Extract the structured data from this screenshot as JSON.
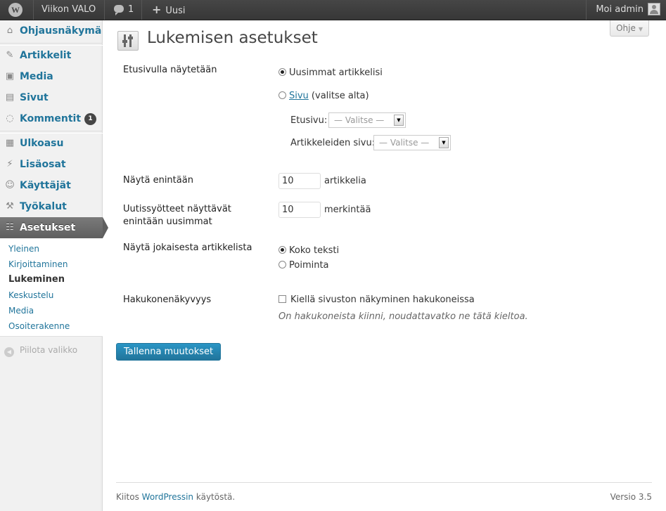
{
  "admin_bar": {
    "site_name": "Viikon VALO",
    "comments_count": "1",
    "new_label": "Uusi",
    "account_label": "Moi admin"
  },
  "sidebar": {
    "items": [
      {
        "label": "Ohjausnäkymä",
        "icon": "dashboard-icon"
      },
      {
        "label": "Artikkelit",
        "icon": "pin-icon"
      },
      {
        "label": "Media",
        "icon": "media-icon"
      },
      {
        "label": "Sivut",
        "icon": "pages-icon"
      },
      {
        "label": "Kommentit",
        "icon": "comments-icon",
        "badge": "1"
      },
      {
        "label": "Ulkoasu",
        "icon": "appearance-icon"
      },
      {
        "label": "Lisäosat",
        "icon": "plugins-icon"
      },
      {
        "label": "Käyttäjät",
        "icon": "users-icon"
      },
      {
        "label": "Työkalut",
        "icon": "tools-icon"
      },
      {
        "label": "Asetukset",
        "icon": "settings-icon",
        "active": true
      }
    ],
    "submenu": [
      "Yleinen",
      "Kirjoittaminen",
      "Lukeminen",
      "Keskustelu",
      "Media",
      "Osoiterakenne"
    ],
    "current_submenu": "Lukeminen",
    "collapse_label": "Piilota valikko"
  },
  "help_tab": "Ohje",
  "page_title": "Lukemisen asetukset",
  "form": {
    "front_page": {
      "label": "Etusivulla näytetään",
      "option_latest": "Uusimmat artikkelisi",
      "option_page_link": "Sivu",
      "option_page_suffix": " (valitse alta)",
      "selected": "latest",
      "front_label": "Etusivu:",
      "front_value": "— Valitse —",
      "posts_label": "Artikkeleiden sivu:",
      "posts_value": "— Valitse —"
    },
    "posts_per_page": {
      "label": "Näytä enintään",
      "value": "10",
      "unit": "artikkelia"
    },
    "feed_items": {
      "label_line1": "Uutissyötteet näyttävät",
      "label_line2": "enintään uusimmat",
      "value": "10",
      "unit": "merkintää"
    },
    "feed_content": {
      "label": "Näytä jokaisesta artikkelista",
      "option_full": "Koko teksti",
      "option_summary": "Poiminta",
      "selected": "full"
    },
    "visibility": {
      "label": "Hakukonenäkyvyys",
      "checkbox_label": "Kiellä sivuston näkyminen hakukoneissa",
      "checked": false,
      "hint": "On hakukoneista kiinni, noudattavatko ne tätä kieltoa."
    },
    "save_label": "Tallenna muutokset"
  },
  "footer": {
    "thanks_prefix": "Kiitos ",
    "thanks_link": "WordPressin",
    "thanks_suffix": " käytöstä.",
    "version": "Versio 3.5"
  },
  "colors": {
    "link": "#21759b",
    "adminbar": "#464646",
    "active_menu": "#6d6d6d"
  }
}
